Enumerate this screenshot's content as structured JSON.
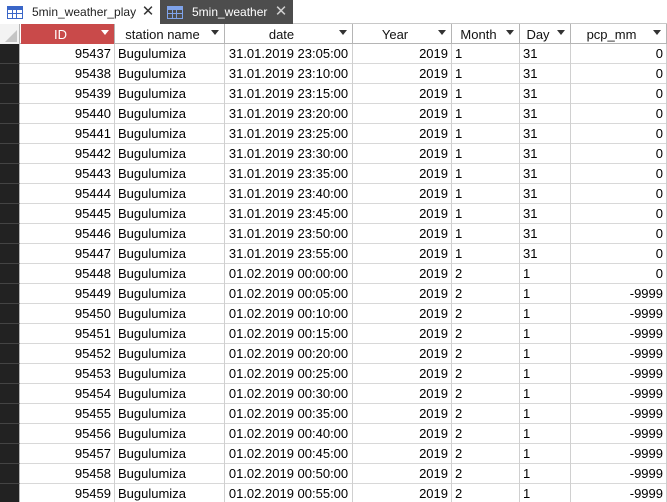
{
  "tabs": [
    {
      "label": "5min_weather_play",
      "active": false
    },
    {
      "label": "5min_weather",
      "active": true
    }
  ],
  "columns": [
    {
      "key": "id",
      "label": "ID"
    },
    {
      "key": "station",
      "label": "station name"
    },
    {
      "key": "date",
      "label": "date"
    },
    {
      "key": "year",
      "label": "Year"
    },
    {
      "key": "month",
      "label": "Month"
    },
    {
      "key": "day",
      "label": "Day"
    },
    {
      "key": "pcp",
      "label": "pcp_mm"
    }
  ],
  "rows": [
    [
      "95437",
      "Bugulumiza",
      "31.01.2019 23:05:00",
      "2019",
      "1",
      "31",
      "0"
    ],
    [
      "95438",
      "Bugulumiza",
      "31.01.2019 23:10:00",
      "2019",
      "1",
      "31",
      "0"
    ],
    [
      "95439",
      "Bugulumiza",
      "31.01.2019 23:15:00",
      "2019",
      "1",
      "31",
      "0"
    ],
    [
      "95440",
      "Bugulumiza",
      "31.01.2019 23:20:00",
      "2019",
      "1",
      "31",
      "0"
    ],
    [
      "95441",
      "Bugulumiza",
      "31.01.2019 23:25:00",
      "2019",
      "1",
      "31",
      "0"
    ],
    [
      "95442",
      "Bugulumiza",
      "31.01.2019 23:30:00",
      "2019",
      "1",
      "31",
      "0"
    ],
    [
      "95443",
      "Bugulumiza",
      "31.01.2019 23:35:00",
      "2019",
      "1",
      "31",
      "0"
    ],
    [
      "95444",
      "Bugulumiza",
      "31.01.2019 23:40:00",
      "2019",
      "1",
      "31",
      "0"
    ],
    [
      "95445",
      "Bugulumiza",
      "31.01.2019 23:45:00",
      "2019",
      "1",
      "31",
      "0"
    ],
    [
      "95446",
      "Bugulumiza",
      "31.01.2019 23:50:00",
      "2019",
      "1",
      "31",
      "0"
    ],
    [
      "95447",
      "Bugulumiza",
      "31.01.2019 23:55:00",
      "2019",
      "1",
      "31",
      "0"
    ],
    [
      "95448",
      "Bugulumiza",
      "01.02.2019 00:00:00",
      "2019",
      "2",
      "1",
      "0"
    ],
    [
      "95449",
      "Bugulumiza",
      "01.02.2019 00:05:00",
      "2019",
      "2",
      "1",
      "-9999"
    ],
    [
      "95450",
      "Bugulumiza",
      "01.02.2019 00:10:00",
      "2019",
      "2",
      "1",
      "-9999"
    ],
    [
      "95451",
      "Bugulumiza",
      "01.02.2019 00:15:00",
      "2019",
      "2",
      "1",
      "-9999"
    ],
    [
      "95452",
      "Bugulumiza",
      "01.02.2019 00:20:00",
      "2019",
      "2",
      "1",
      "-9999"
    ],
    [
      "95453",
      "Bugulumiza",
      "01.02.2019 00:25:00",
      "2019",
      "2",
      "1",
      "-9999"
    ],
    [
      "95454",
      "Bugulumiza",
      "01.02.2019 00:30:00",
      "2019",
      "2",
      "1",
      "-9999"
    ],
    [
      "95455",
      "Bugulumiza",
      "01.02.2019 00:35:00",
      "2019",
      "2",
      "1",
      "-9999"
    ],
    [
      "95456",
      "Bugulumiza",
      "01.02.2019 00:40:00",
      "2019",
      "2",
      "1",
      "-9999"
    ],
    [
      "95457",
      "Bugulumiza",
      "01.02.2019 00:45:00",
      "2019",
      "2",
      "1",
      "-9999"
    ],
    [
      "95458",
      "Bugulumiza",
      "01.02.2019 00:50:00",
      "2019",
      "2",
      "1",
      "-9999"
    ],
    [
      "95459",
      "Bugulumiza",
      "01.02.2019 00:55:00",
      "2019",
      "2",
      "1",
      "-9999"
    ]
  ]
}
